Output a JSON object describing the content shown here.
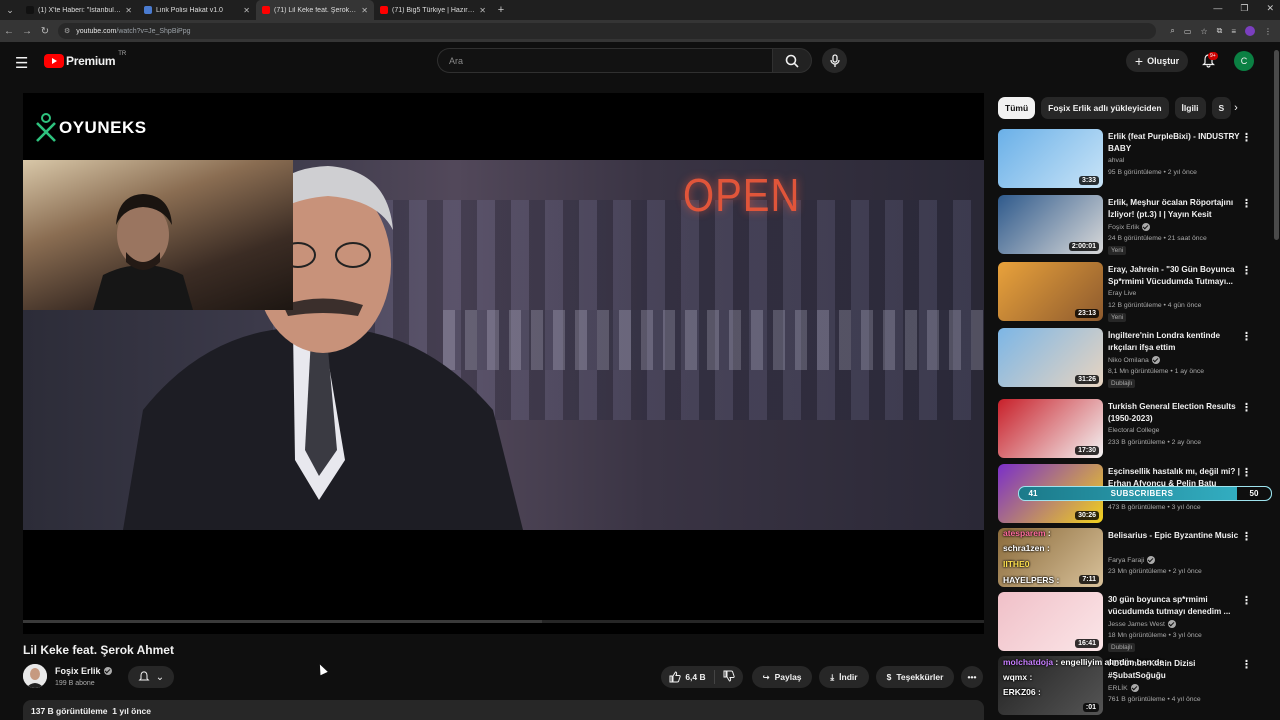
{
  "browser": {
    "tabs": [
      {
        "title": "(1) X'te Haberi: \"İstanbul'da bir...",
        "color": "#111111",
        "active": false
      },
      {
        "title": "Link Polisi Hakat v1.0",
        "color": "#4a7bd0",
        "active": false
      },
      {
        "title": "(71) Lil Keke feat. Şerok Ah...",
        "color": "#ff0000",
        "active": true
      },
      {
        "title": "(71) Big5 Türkiye | Hazırlık Sez...",
        "color": "#ff0000",
        "active": false
      }
    ],
    "url_host": "youtube.com",
    "url_path": "/watch?v=Je_ShpBiPpg"
  },
  "header": {
    "logo_text": "Premium",
    "region": "TR",
    "search_placeholder": "Ara",
    "create_label": "Oluştur",
    "notification_count": "9+",
    "avatar_letter": "C"
  },
  "player": {
    "overlay_brand": "OYUNEKS",
    "sign_text": "OPEN",
    "progress_fraction": 0.54
  },
  "video": {
    "title": "Lil Keke feat. Şerok Ahmet",
    "channel": "Foşix Erlik",
    "subscribers": "199 B abone",
    "likes": "6,4 B",
    "share_label": "Paylaş",
    "download_label": "İndir",
    "thanks_label": "Teşekkürler",
    "views": "137 B görüntüleme",
    "age": "1 yıl önce"
  },
  "sidebar": {
    "chips": [
      "Tümü",
      "Foşix Erlik adlı yükleyiciden",
      "İlgili",
      "S"
    ],
    "recommendations": [
      {
        "title": "Erlik (feat PurpleBixi) - INDUSTRY BABY",
        "channel": "ahval",
        "verified": false,
        "meta": "95 B görüntüleme • 2 yıl önce",
        "duration": "3:33",
        "badge": "",
        "colors": [
          "#6ab0e8",
          "#c9e4f7"
        ]
      },
      {
        "title": "Erlik, Meşhur öcalan Röportajını İzliyor! (pt.3) I  | Yayın Kesit",
        "channel": "Foşix Erlik",
        "verified": true,
        "meta": "24 B görüntüleme • 21 saat önce",
        "duration": "2:00:01",
        "badge": "Yeni",
        "colors": [
          "#2f5a8c",
          "#d9d9d9"
        ]
      },
      {
        "title": "Eray, Jahrein - \"30 Gün Boyunca Sp*rmimi Vücudumda Tutmayı...",
        "channel": "Eray Live",
        "verified": false,
        "meta": "12 B görüntüleme • 4 gün önce",
        "duration": "23:13",
        "badge": "Yeni",
        "colors": [
          "#e9a23b",
          "#8d5a2e"
        ]
      },
      {
        "title": "İngiltere'nin Londra kentinde ırkçıları ifşa ettim",
        "channel": "Niko Omilana",
        "verified": true,
        "meta": "8,1 Mn görüntüleme • 1 ay önce",
        "duration": "31:26",
        "badge": "Dublajlı",
        "colors": [
          "#7cb6e6",
          "#e8d4c0"
        ]
      },
      {
        "title": "Turkish General Election Results (1950-2023)",
        "channel": "Electoral College",
        "verified": false,
        "meta": "233 B görüntüleme • 2 ay önce",
        "duration": "17:30",
        "badge": "",
        "colors": [
          "#c8202a",
          "#f4f4f4"
        ]
      },
      {
        "title": "Eşcinsellik hastalık mı, değil mi? | Erhan Afyoncu & Pelin Batu",
        "channel": "",
        "verified": false,
        "meta": "473 B görüntüleme • 3 yıl önce",
        "duration": "30:26",
        "badge": "",
        "colors": [
          "#7a2fc9",
          "#f2d21c"
        ]
      },
      {
        "title": "Belisarius - Epic Byzantine Music",
        "channel": "Farya Faraji",
        "verified": true,
        "meta": "23 Mn görüntüleme • 2 yıl önce",
        "duration": "7:11",
        "badge": "",
        "colors": [
          "#8a6a3a",
          "#d8c19a"
        ]
      },
      {
        "title": "30 gün boyunca sp*rmimi vücudumda tutmayı denedim ...",
        "channel": "Jesse James West",
        "verified": true,
        "meta": "18 Mn görüntüleme • 3 yıl önce",
        "duration": "16:41",
        "badge": "Dublajlı",
        "colors": [
          "#f0c0c8",
          "#fbe6e8"
        ]
      },
      {
        "title": "FETÖ'nün Kahin Dizisi #ŞubatSoğuğu",
        "channel": "ERLİK",
        "verified": true,
        "meta": "761 B görüntüleme • 4 yıl önce",
        "duration": ":01",
        "badge": "",
        "colors": [
          "#222222",
          "#555555"
        ]
      }
    ]
  },
  "stream_overlay": {
    "subscriber_goal": {
      "current": "41",
      "label": "SUBSCRIBERS",
      "target": "50",
      "fraction": 0.82
    },
    "chat": [
      {
        "user": "atesparem",
        "text": ":",
        "color": "#ff6b9d",
        "topOffset": 0
      },
      {
        "user": "schra1zen",
        "text": ":",
        "color": "#ffffff",
        "topOffset": 0
      },
      {
        "user": "IITHE0",
        "text": "",
        "color": "#ffe14d",
        "topOffset": 0
      },
      {
        "user": "HAYELPERS",
        "text": ":",
        "color": "#ffffff",
        "topOffset": 0
      },
      {
        "user": "molchatdoja",
        "text": ": engelliyim alındım ben de",
        "color": "#c77dff",
        "topOffset": 0
      },
      {
        "user": "wqmx",
        "text": ":",
        "color": "#ffffff",
        "topOffset": 0
      },
      {
        "user": "ERKZ06",
        "text": ":",
        "color": "#ffffff",
        "topOffset": 0
      }
    ]
  }
}
